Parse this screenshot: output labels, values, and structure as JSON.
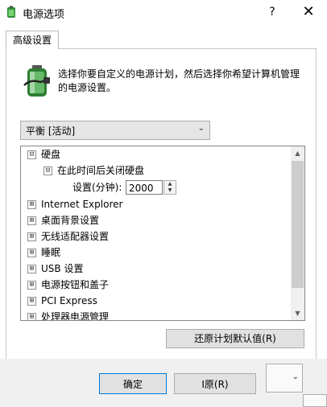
{
  "window": {
    "title": "电源选项",
    "help_label": "?",
    "close_label": "✕"
  },
  "tabs": [
    {
      "label": "高级设置"
    }
  ],
  "description": "选择你要自定义的电源计划，然后选择你希望计算机管理的电源设置。",
  "plan_select": {
    "value": "平衡 [活动]"
  },
  "tree": {
    "items": [
      {
        "expander": "⊟",
        "label": "硬盘"
      },
      {
        "expander": "⊟",
        "label": "在此时间后关闭硬盘"
      },
      {
        "expander": "⊞",
        "label": "Internet Explorer"
      },
      {
        "expander": "⊞",
        "label": "桌面背景设置"
      },
      {
        "expander": "⊞",
        "label": "无线适配器设置"
      },
      {
        "expander": "⊞",
        "label": "睡眠"
      },
      {
        "expander": "⊞",
        "label": "USB 设置"
      },
      {
        "expander": "⊞",
        "label": "电源按钮和盖子"
      },
      {
        "expander": "⊞",
        "label": "PCI Express"
      },
      {
        "expander": "⊞",
        "label": "处理器电源管理"
      }
    ],
    "setting": {
      "label": "设置(分钟):",
      "value": "2000"
    }
  },
  "buttons": {
    "restore": "还原计划默认值(R)",
    "ok": "确定",
    "cancel": "I原(R)"
  }
}
